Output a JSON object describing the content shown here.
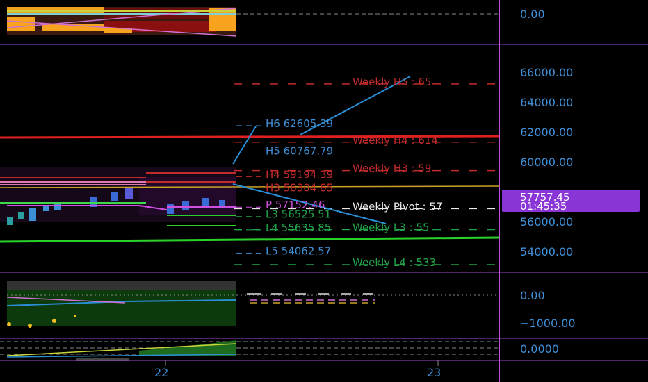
{
  "colors": {
    "background": "#000000",
    "axis_text": "#3f8fd6",
    "separator": "#a14ad6",
    "pivot_red": "#c22b2b",
    "pivot_green": "#22a34a",
    "weekly_line_blue": "#2a8fd6",
    "price_tag_bg": "#8a35d6",
    "h_line_red": "#e0201e",
    "l_line_green": "#2bd12b",
    "yellow_line": "#c9a227"
  },
  "price_axis": {
    "ticks": [
      "66000.00",
      "64000.00",
      "62000.00",
      "60000.00",
      "56000.00",
      "54000.00"
    ]
  },
  "current_price": {
    "price": "57757.45",
    "countdown": "01:45:35"
  },
  "top_pane": {
    "tick": "0.00"
  },
  "osc_pane": {
    "ticks": [
      "0.00",
      "−1000.00"
    ]
  },
  "bottom_pane": {
    "tick": "0.0000"
  },
  "time_axis": {
    "labels": [
      "22",
      "23"
    ]
  },
  "chart_data": {
    "type": "line",
    "title": "",
    "ylim": [
      53000,
      67000
    ],
    "daily_pivots": [
      {
        "label": "H6 62605.39",
        "value": 62605.39
      },
      {
        "label": "H5 60767.79",
        "value": 60767.79
      },
      {
        "label": "H4 59194.39",
        "value": 59194.39
      },
      {
        "label": "H3 58304.85",
        "value": 58304.85
      },
      {
        "label": "P 57152.46",
        "value": 57152.46
      },
      {
        "label": "L3 56525.51",
        "value": 56525.51
      },
      {
        "label": "L4 55635.85",
        "value": 55635.85
      },
      {
        "label": "L5 54062.57",
        "value": 54062.57
      }
    ],
    "weekly_pivots": [
      {
        "label": "Weekly H5 : 65",
        "value": 65400
      },
      {
        "label": "Weekly H4 : 614",
        "value": 61500
      },
      {
        "label": "Weekly H3 : 59",
        "value": 59600
      },
      {
        "label": "Weekly Pivot : 57",
        "value": 57050
      },
      {
        "label": "Weekly L3 : 55",
        "value": 55650
      },
      {
        "label": "Weekly L4 : 533",
        "value": 53300
      }
    ],
    "current_price": 57757.45
  }
}
